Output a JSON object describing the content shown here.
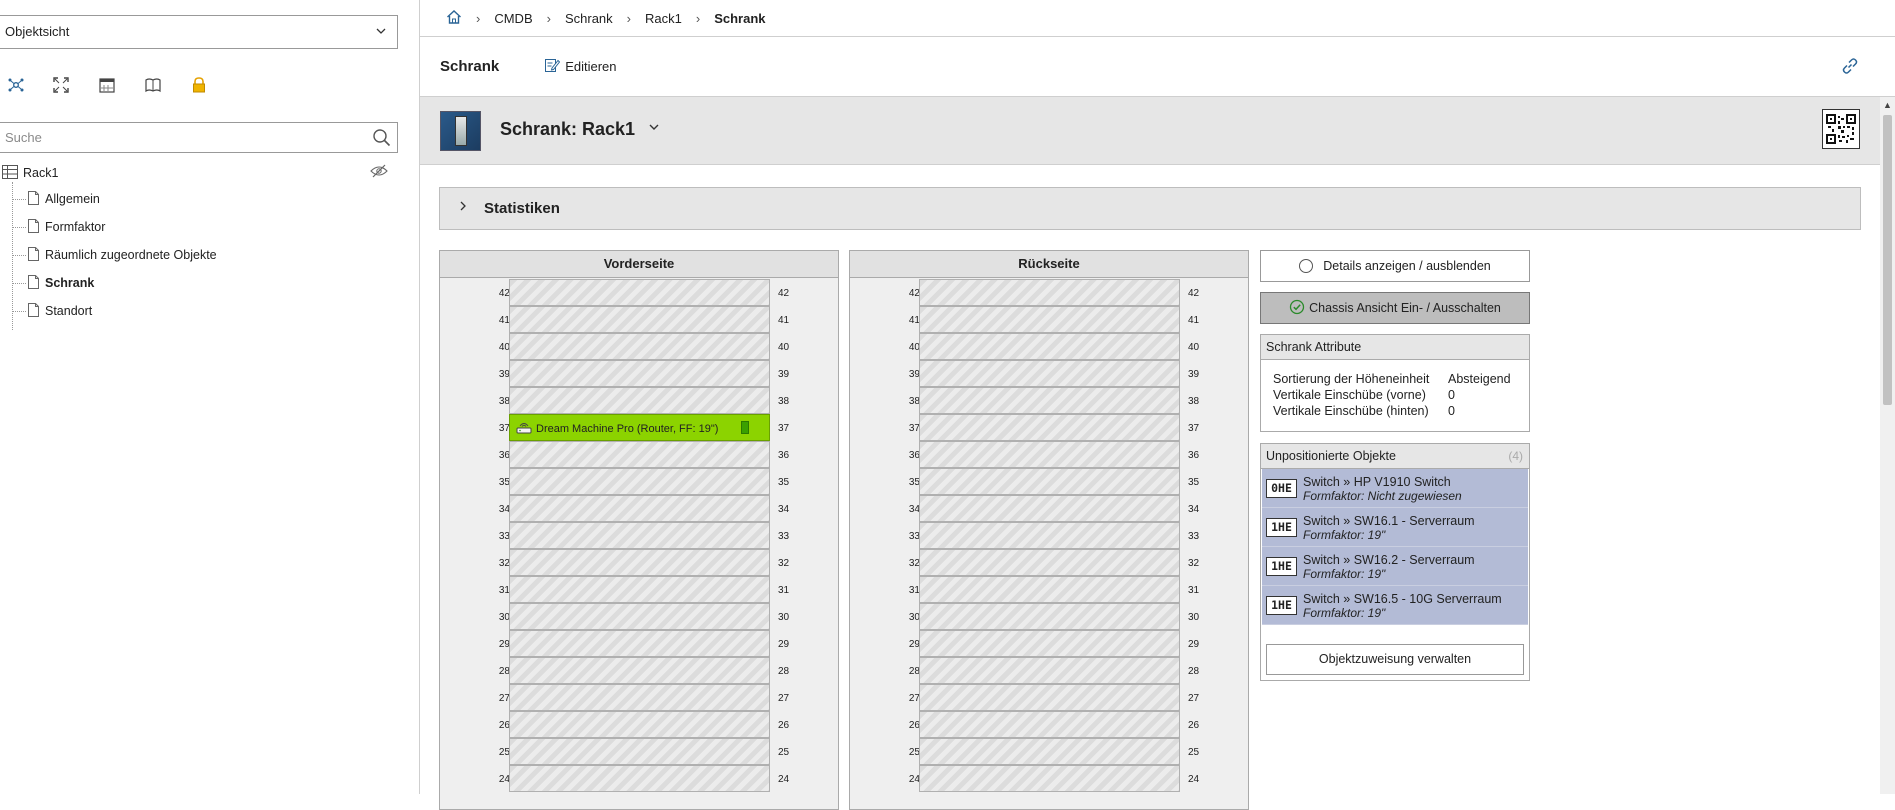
{
  "sidebar": {
    "view_select": "Objektsicht",
    "toolbar_icons": [
      "network-icon",
      "expand-icon",
      "calendar-icon",
      "book-icon",
      "lock-icon"
    ],
    "search_placeholder": "Suche",
    "tree": {
      "root": "Rack1",
      "items": [
        {
          "label": "Allgemein",
          "active": false
        },
        {
          "label": "Formfaktor",
          "active": false
        },
        {
          "label": "Räumlich zugeordnete Objekte",
          "active": false
        },
        {
          "label": "Schrank",
          "active": true
        },
        {
          "label": "Standort",
          "active": false
        }
      ]
    }
  },
  "breadcrumb": [
    "CMDB",
    "Schrank",
    "Rack1",
    "Schrank"
  ],
  "header": {
    "title": "Schrank",
    "edit_label": "Editieren"
  },
  "object": {
    "title": "Schrank: Rack1"
  },
  "statistics": {
    "title": "Statistiken"
  },
  "rack": {
    "front_title": "Vorderseite",
    "back_title": "Rückseite",
    "units": [
      42,
      41,
      40,
      39,
      38,
      37,
      36,
      35,
      34,
      33,
      32,
      31,
      30,
      29,
      28,
      27,
      26,
      25,
      24
    ],
    "front_devices": [
      {
        "unit": 37,
        "label": "Dream Machine Pro (Router, FF: 19\")",
        "color": "#8cd300"
      }
    ]
  },
  "actions": {
    "details": "Details anzeigen / ausblenden",
    "chassis": "Chassis Ansicht Ein- / Ausschalten"
  },
  "attributes": {
    "title": "Schrank Attribute",
    "rows": [
      {
        "label": "Sortierung der Höheneinheit",
        "value": "Absteigend"
      },
      {
        "label": "Vertikale Einschübe (vorne)",
        "value": "0"
      },
      {
        "label": "Vertikale Einschübe (hinten)",
        "value": "0"
      }
    ]
  },
  "unpositioned": {
    "title": "Unpositionierte Objekte",
    "count": "(4)",
    "items": [
      {
        "he": "0HE",
        "title": "Switch » HP V1910 Switch",
        "sub": "Formfaktor: Nicht zugewiesen"
      },
      {
        "he": "1HE",
        "title": "Switch » SW16.1 - Serverraum",
        "sub": "Formfaktor: 19\""
      },
      {
        "he": "1HE",
        "title": "Switch » SW16.2 - Serverraum",
        "sub": "Formfaktor: 19\""
      },
      {
        "he": "1HE",
        "title": "Switch » SW16.5 - 10G Serverraum",
        "sub": "Formfaktor: 19\""
      }
    ],
    "manage_label": "Objektzuweisung verwalten"
  },
  "colors": {
    "accent": "#2a6496",
    "device_green": "#8cd300",
    "unpositioned_bg": "#b3bbd6",
    "header_bg": "#e6e6e6"
  }
}
